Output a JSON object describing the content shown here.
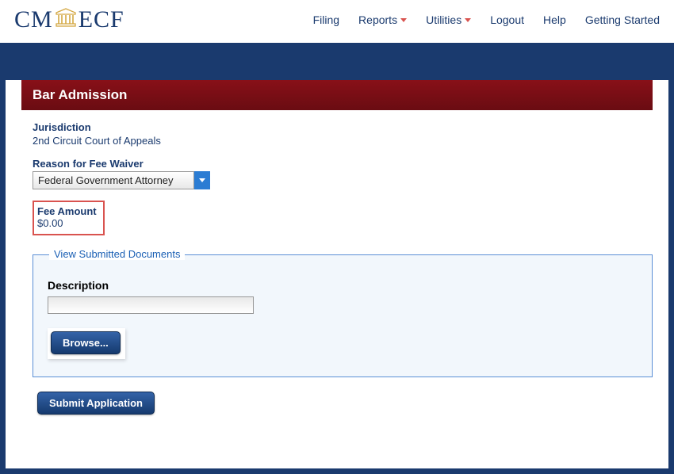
{
  "logo": {
    "left": "CM",
    "right": "ECF"
  },
  "nav": {
    "filing": "Filing",
    "reports": "Reports",
    "utilities": "Utilities",
    "logout": "Logout",
    "help": "Help",
    "getting_started": "Getting Started"
  },
  "page": {
    "header": "Bar Admission",
    "jurisdiction_label": "Jurisdiction",
    "jurisdiction_value": "2nd Circuit Court of Appeals",
    "reason_label": "Reason for Fee Waiver",
    "reason_selected": "Federal Government Attorney",
    "fee_label": "Fee Amount",
    "fee_value": "$0.00",
    "documents_legend": "View Submitted Documents",
    "description_label": "Description",
    "description_value": "",
    "browse_label": "Browse...",
    "submit_label": "Submit Application"
  }
}
